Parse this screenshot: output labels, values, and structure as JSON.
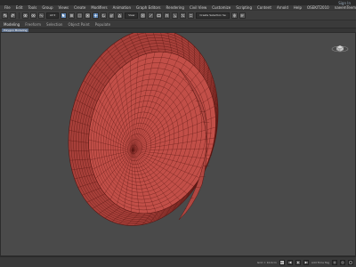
{
  "titlebar": {
    "title": "",
    "signin": "Sign In"
  },
  "menu": [
    "File",
    "Edit",
    "Tools",
    "Group",
    "Views",
    "Create",
    "Modifiers",
    "Animation",
    "Graph Editors",
    "Rendering",
    "Civil View",
    "Customize",
    "Scripting",
    "Content",
    "Arnold",
    "Help",
    "OSEKIT2010",
    "naeemTeemo"
  ],
  "toolbar": {
    "view_select": "View",
    "selection_set": "Create Selection Se"
  },
  "ribbon": {
    "tabs": [
      {
        "label": "Modeling",
        "active": true
      },
      {
        "label": "Freeform",
        "active": false
      },
      {
        "label": "Selection",
        "active": false
      },
      {
        "label": "Object Paint",
        "active": false
      },
      {
        "label": "Populate",
        "active": false
      }
    ]
  },
  "subbar": {
    "tag": "Polygon Modeling"
  },
  "viewport": {
    "label": "[+] [Perspective] [Standard] [Default Shading]",
    "mesh_color": "#b84a44",
    "wire_color": "#5a1814"
  },
  "status": {
    "selection": "1 Object Selected",
    "prompt": "Click or click-and-drag to select objects",
    "grid": "Grid = 10.0cm",
    "time_tag": "Add Time Tag",
    "frame": "0"
  }
}
